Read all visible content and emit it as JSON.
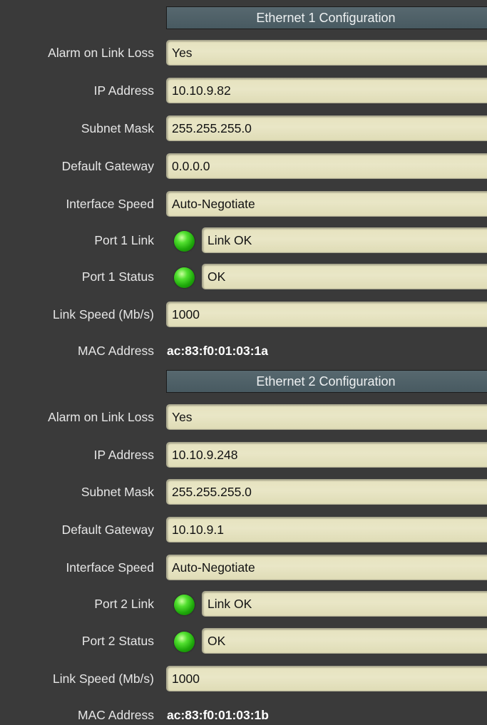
{
  "sections": [
    {
      "title": "Ethernet 1 Configuration",
      "rows": {
        "alarm": {
          "label": "Alarm on Link Loss",
          "value": "Yes"
        },
        "ip": {
          "label": "IP Address",
          "value": "10.10.9.82"
        },
        "subnet": {
          "label": "Subnet Mask",
          "value": "255.255.255.0"
        },
        "gateway": {
          "label": "Default Gateway",
          "value": "0.0.0.0"
        },
        "speed_mode": {
          "label": "Interface Speed",
          "value": "Auto-Negotiate"
        },
        "port_link": {
          "label": "Port 1 Link",
          "value": "Link OK",
          "indicator": "green"
        },
        "port_status": {
          "label": "Port 1 Status",
          "value": "OK",
          "indicator": "green"
        },
        "link_speed": {
          "label": "Link Speed (Mb/s)",
          "value": "1000"
        },
        "mac": {
          "label": "MAC Address",
          "value": "ac:83:f0:01:03:1a"
        }
      }
    },
    {
      "title": "Ethernet 2 Configuration",
      "rows": {
        "alarm": {
          "label": "Alarm on Link Loss",
          "value": "Yes"
        },
        "ip": {
          "label": "IP Address",
          "value": "10.10.9.248"
        },
        "subnet": {
          "label": "Subnet Mask",
          "value": "255.255.255.0"
        },
        "gateway": {
          "label": "Default Gateway",
          "value": "10.10.9.1"
        },
        "speed_mode": {
          "label": "Interface Speed",
          "value": "Auto-Negotiate"
        },
        "port_link": {
          "label": "Port 2 Link",
          "value": "Link OK",
          "indicator": "green"
        },
        "port_status": {
          "label": "Port 2 Status",
          "value": "OK",
          "indicator": "green"
        },
        "link_speed": {
          "label": "Link Speed (Mb/s)",
          "value": "1000"
        },
        "mac": {
          "label": "MAC Address",
          "value": "ac:83:f0:01:03:1b"
        }
      }
    }
  ],
  "colors": {
    "panel_background": "#3a3a3a",
    "header_background": "#4f6168",
    "field_background": "#e7e4c2",
    "indicator_ok": "#2ec814"
  }
}
